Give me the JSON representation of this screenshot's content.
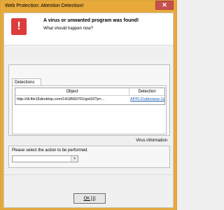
{
  "window": {
    "title": "Web Protection: Attention Detection!",
    "close_glyph": "✕"
  },
  "header": {
    "icon": "exclamation-icon",
    "icon_glyph": "!",
    "title": "A virus or unwanted program was found!",
    "subtitle": "What should happen now?"
  },
  "detections": {
    "tab_label": "Detections",
    "columns": [
      "Object",
      "Detection"
    ],
    "rows": [
      {
        "object": "http://dl.file16desktop.com/1418560701/get10?p=...",
        "detection": "APPL/Outbrowse.Gen"
      }
    ]
  },
  "virus_info_label": "Virus information",
  "action": {
    "label": "Please select the action to be performed.",
    "selected": ""
  },
  "buttons": {
    "ok": "OK [1]"
  },
  "colors": {
    "titlebar": "#e8a93b",
    "close_button": "#c75050",
    "alert_icon": "#dc3c3c",
    "link": "#1a5fb4"
  }
}
